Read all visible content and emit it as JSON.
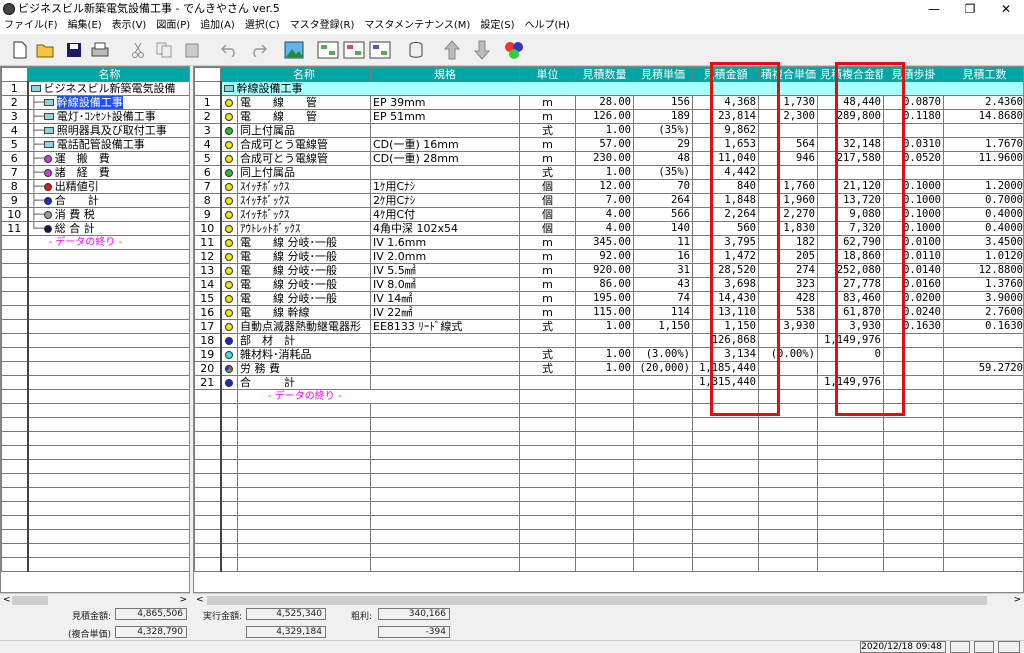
{
  "window": {
    "title": "ビジネスビル新築電気設備工事 - でんきやさん ver.5"
  },
  "menu": [
    "ファイル(F)",
    "編集(E)",
    "表示(V)",
    "図面(P)",
    "追加(A)",
    "選択(C)",
    "マスタ登録(R)",
    "マスタメンテナンス(M)",
    "設定(S)",
    "ヘルプ(H)"
  ],
  "toolbar_icons": [
    "new-icon",
    "open-icon",
    "save-icon",
    "print-icon",
    "cut-icon",
    "copy-icon",
    "paste-icon",
    "undo-icon",
    "redo-icon",
    "image-icon",
    "tree-a-icon",
    "tree-b-icon",
    "tree-c-icon",
    "database-icon",
    "up-arrow-icon",
    "down-arrow-icon",
    "color-balls-icon"
  ],
  "tree": {
    "header": "名称",
    "rows": [
      {
        "n": "1",
        "label": "ビジネスビル新築電気設備",
        "icon": "book",
        "indent": 0
      },
      {
        "n": "2",
        "label": "幹線設備工事",
        "icon": "book",
        "indent": 1,
        "selected": true
      },
      {
        "n": "3",
        "label": "電灯･ｺﾝｾﾝﾄ設備工事",
        "icon": "book",
        "indent": 1
      },
      {
        "n": "4",
        "label": "照明器具及び取付工事",
        "icon": "book",
        "indent": 1
      },
      {
        "n": "5",
        "label": "電話配管設備工事",
        "icon": "book",
        "indent": 1
      },
      {
        "n": "6",
        "label": "運　搬　費",
        "icon": "purple",
        "indent": 1
      },
      {
        "n": "7",
        "label": "諸　経　費",
        "icon": "purple",
        "indent": 1
      },
      {
        "n": "8",
        "label": "出精値引",
        "icon": "red",
        "indent": 1
      },
      {
        "n": "9",
        "label": "合　　計",
        "icon": "blue",
        "indent": 1
      },
      {
        "n": "10",
        "label": "消 費 税",
        "icon": "gray",
        "indent": 1
      },
      {
        "n": "11",
        "label": "総 合 計",
        "icon": "navy",
        "indent": 1
      }
    ],
    "end": "- データの終り -"
  },
  "grid": {
    "headers": [
      "名称",
      "規格",
      "単位",
      "見積数量",
      "見積単価",
      "見積金額",
      "積複合単価",
      "見積複合金額",
      "見積歩掛",
      "見積工数"
    ],
    "group_label": "幹線設備工事",
    "rows": [
      {
        "n": "1",
        "icon": "yellow",
        "name": "電　　線　　管",
        "spec": "EP 39mm",
        "unit": "m",
        "qty": "28.00",
        "price": "156",
        "amount": "4,368",
        "cunit": "1,730",
        "camount": "48,440",
        "bugake": "0.0870",
        "kosu": "2.4360"
      },
      {
        "n": "2",
        "icon": "yellow",
        "name": "電　　線　　管",
        "spec": "EP 51mm",
        "unit": "m",
        "qty": "126.00",
        "price": "189",
        "amount": "23,814",
        "cunit": "2,300",
        "camount": "289,800",
        "bugake": "0.1180",
        "kosu": "14.8680"
      },
      {
        "n": "3",
        "icon": "green",
        "name": "同上付属品",
        "spec": "",
        "unit": "式",
        "qty": "1.00",
        "price": "(35%)",
        "amount": "9,862",
        "cunit": "",
        "camount": "",
        "bugake": "",
        "kosu": ""
      },
      {
        "n": "4",
        "icon": "yellow",
        "name": "合成可とう電線管",
        "spec": "CD(一重) 16mm",
        "unit": "m",
        "qty": "57.00",
        "price": "29",
        "amount": "1,653",
        "cunit": "564",
        "camount": "32,148",
        "bugake": "0.0310",
        "kosu": "1.7670"
      },
      {
        "n": "5",
        "icon": "yellow",
        "name": "合成可とう電線管",
        "spec": "CD(一重) 28mm",
        "unit": "m",
        "qty": "230.00",
        "price": "48",
        "amount": "11,040",
        "cunit": "946",
        "camount": "217,580",
        "bugake": "0.0520",
        "kosu": "11.9600"
      },
      {
        "n": "6",
        "icon": "green",
        "name": "同上付属品",
        "spec": "",
        "unit": "式",
        "qty": "1.00",
        "price": "(35%)",
        "amount": "4,442",
        "cunit": "",
        "camount": "",
        "bugake": "",
        "kosu": ""
      },
      {
        "n": "7",
        "icon": "yellow",
        "name": "ｽｲｯﾁﾎﾞｯｸｽ",
        "spec": "1ｹ用Cﾅｼ",
        "unit": "個",
        "qty": "12.00",
        "price": "70",
        "amount": "840",
        "cunit": "1,760",
        "camount": "21,120",
        "bugake": "0.1000",
        "kosu": "1.2000"
      },
      {
        "n": "8",
        "icon": "yellow",
        "name": "ｽｲｯﾁﾎﾞｯｸｽ",
        "spec": "2ｹ用Cﾅｼ",
        "unit": "個",
        "qty": "7.00",
        "price": "264",
        "amount": "1,848",
        "cunit": "1,960",
        "camount": "13,720",
        "bugake": "0.1000",
        "kosu": "0.7000"
      },
      {
        "n": "9",
        "icon": "yellow",
        "name": "ｽｲｯﾁﾎﾞｯｸｽ",
        "spec": "4ｹ用C付",
        "unit": "個",
        "qty": "4.00",
        "price": "566",
        "amount": "2,264",
        "cunit": "2,270",
        "camount": "9,080",
        "bugake": "0.1000",
        "kosu": "0.4000"
      },
      {
        "n": "10",
        "icon": "yellow",
        "name": "ｱｳﾄﾚｯﾄﾎﾞｯｸｽ",
        "spec": "4角中深 102x54",
        "unit": "個",
        "qty": "4.00",
        "price": "140",
        "amount": "560",
        "cunit": "1,830",
        "camount": "7,320",
        "bugake": "0.1000",
        "kosu": "0.4000"
      },
      {
        "n": "11",
        "icon": "yellow",
        "name": "電　　線 分岐･一般",
        "spec": "IV 1.6mm",
        "unit": "m",
        "qty": "345.00",
        "price": "11",
        "amount": "3,795",
        "cunit": "182",
        "camount": "62,790",
        "bugake": "0.0100",
        "kosu": "3.4500"
      },
      {
        "n": "12",
        "icon": "yellow",
        "name": "電　　線 分岐･一般",
        "spec": "IV 2.0mm",
        "unit": "m",
        "qty": "92.00",
        "price": "16",
        "amount": "1,472",
        "cunit": "205",
        "camount": "18,860",
        "bugake": "0.0110",
        "kosu": "1.0120"
      },
      {
        "n": "13",
        "icon": "yellow",
        "name": "電　　線 分岐･一般",
        "spec": "IV 5.5㎟",
        "unit": "m",
        "qty": "920.00",
        "price": "31",
        "amount": "28,520",
        "cunit": "274",
        "camount": "252,080",
        "bugake": "0.0140",
        "kosu": "12.8800"
      },
      {
        "n": "14",
        "icon": "yellow",
        "name": "電　　線 分岐･一般",
        "spec": "IV 8.0㎟",
        "unit": "m",
        "qty": "86.00",
        "price": "43",
        "amount": "3,698",
        "cunit": "323",
        "camount": "27,778",
        "bugake": "0.0160",
        "kosu": "1.3760"
      },
      {
        "n": "15",
        "icon": "yellow",
        "name": "電　　線 分岐･一般",
        "spec": "IV 14㎟",
        "unit": "m",
        "qty": "195.00",
        "price": "74",
        "amount": "14,430",
        "cunit": "428",
        "camount": "83,460",
        "bugake": "0.0200",
        "kosu": "3.9000"
      },
      {
        "n": "16",
        "icon": "yellow",
        "name": "電　　線 幹線",
        "spec": "IV 22㎟",
        "unit": "m",
        "qty": "115.00",
        "price": "114",
        "amount": "13,110",
        "cunit": "538",
        "camount": "61,870",
        "bugake": "0.0240",
        "kosu": "2.7600"
      },
      {
        "n": "17",
        "icon": "yellow",
        "name": "自動点滅器熱動継電器形",
        "spec": "EE8133 ﾘｰﾄﾞ線式",
        "unit": "式",
        "qty": "1.00",
        "price": "1,150",
        "amount": "1,150",
        "cunit": "3,930",
        "camount": "3,930",
        "bugake": "0.1630",
        "kosu": "0.1630"
      },
      {
        "n": "18",
        "icon": "blue",
        "name": "部　材　計",
        "spec": "",
        "unit": "",
        "qty": "",
        "price": "",
        "amount": "126,868",
        "cunit": "",
        "camount": "1,149,976",
        "bugake": "",
        "kosu": ""
      },
      {
        "n": "19",
        "icon": "cyan",
        "name": "雑材料･消耗品",
        "spec": "",
        "unit": "式",
        "qty": "1.00",
        "price": "(3.00%)",
        "amount": "3,134",
        "cunit": "(0.00%)",
        "camount": "0",
        "bugake": "",
        "kosu": ""
      },
      {
        "n": "20",
        "icon": "multi",
        "name": "労 務 費",
        "spec": "",
        "unit": "式",
        "qty": "1.00",
        "price": "(20,000)",
        "amount": "1,185,440",
        "cunit": "",
        "camount": "",
        "bugake": "",
        "kosu": "59.2720"
      },
      {
        "n": "21",
        "icon": "blue",
        "name": "合　　　計",
        "spec": "",
        "unit": "",
        "qty": "",
        "price": "",
        "amount": "1,315,440",
        "cunit": "",
        "camount": "1,149,976",
        "bugake": "",
        "kosu": ""
      }
    ],
    "end": "- データの終り -"
  },
  "status": {
    "estimate_label": "見積金額:",
    "estimate_value": "4,865,506",
    "composite_label": "(複合単価)",
    "composite_value": "4,328,790",
    "actual_label": "実行金額:",
    "actual_value": "4,525,340",
    "actual_value2": "4,329,184",
    "profit_label": "粗利:",
    "profit_value": "340,166",
    "profit_value2": "-394",
    "datetime": "2020/12/18 09:48"
  },
  "colors": {
    "header": "#00a6a6",
    "highlight": "#e01010",
    "selected": "#1e50ff",
    "group_row": "#aaffff"
  }
}
